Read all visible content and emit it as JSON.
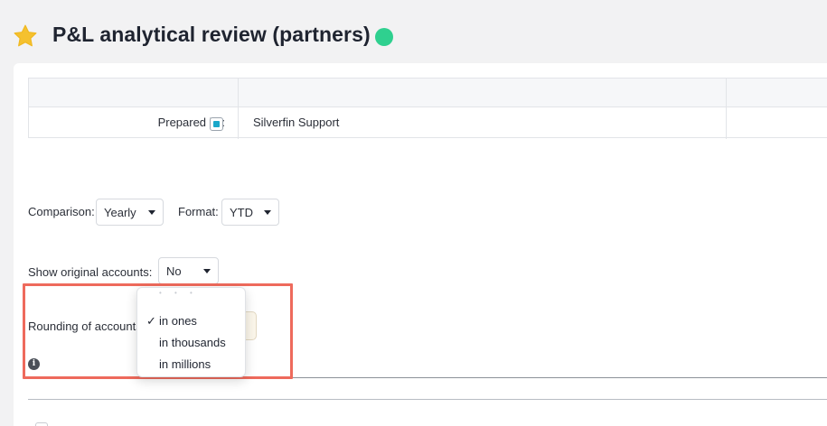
{
  "header": {
    "title": "P&L analytical review (partners)",
    "star_icon": "star-icon",
    "status_color": "#2fd08f"
  },
  "info_table": {
    "prepared_label": "Prepared by:",
    "prepared_value": "Silverfin Support"
  },
  "filters": {
    "comparison_label": "Comparison:",
    "comparison_value": "Yearly",
    "format_label": "Format:",
    "format_value": "YTD",
    "show_original_label": "Show original accounts:",
    "show_original_value": "No",
    "rounding_label": "Rounding of accounts"
  },
  "rounding_menu": {
    "options": [
      {
        "label": "in ones",
        "selected": true
      },
      {
        "label": "in thousands",
        "selected": false
      },
      {
        "label": "in millions",
        "selected": false
      }
    ],
    "check_glyph": "✓"
  },
  "info_icon_glyph": "i",
  "colors": {
    "highlight": "#ee6a5c",
    "checkbox_accent": "#1aa7c9"
  }
}
